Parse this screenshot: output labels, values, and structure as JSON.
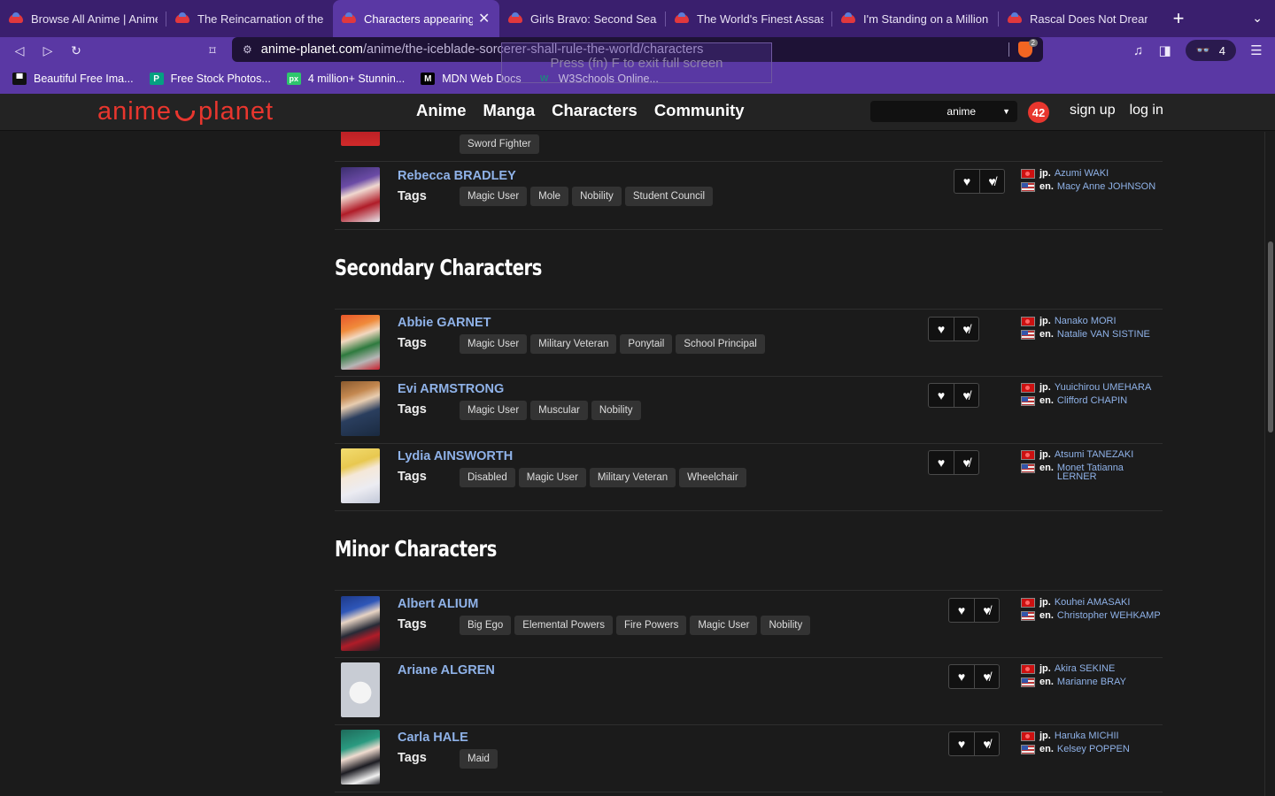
{
  "browser": {
    "tabs": [
      {
        "title": "Browse All Anime | Anime-Planet"
      },
      {
        "title": "The Reincarnation of the Strongest Exorcist"
      },
      {
        "title": "Characters appearing in The Iceblade Sorcerer",
        "active": true
      },
      {
        "title": "Girls Bravo: Second Season"
      },
      {
        "title": "The World's Finest Assassin"
      },
      {
        "title": "I'm Standing on a Million Lives"
      },
      {
        "title": "Rascal Does Not Dream of"
      }
    ],
    "url_host": "anime-planet.com",
    "url_path": "/anime/the-iceblade-sorcerer-shall-rule-the-world/characters",
    "shield_count": "2",
    "wallet_count": "4",
    "fullscreen_hint": "Press  (fn) F  to exit full screen",
    "bookmarks": [
      {
        "label": "Beautiful Free Ima...",
        "icon": "unsplash-icon"
      },
      {
        "label": "Free Stock Photos...",
        "icon": "pexels-icon",
        "icon_text": "P"
      },
      {
        "label": "4 million+ Stunnin...",
        "icon": "pixabay-icon",
        "icon_text": "px"
      },
      {
        "label": "MDN Web Docs",
        "icon": "mdn-icon",
        "icon_text": "M"
      },
      {
        "label": "W3Schools Online...",
        "icon": "w3schools-icon",
        "icon_text": "W"
      }
    ]
  },
  "site": {
    "logo": {
      "left": "anime",
      "right": "planet"
    },
    "nav": [
      "Anime",
      "Manga",
      "Characters",
      "Community"
    ],
    "search_type": "anime",
    "notifications": "42",
    "sign_up": "sign up",
    "log_in": "log in"
  },
  "colors": {
    "accent": "#e8362e",
    "link": "#8fb2e8",
    "browser_purple": "#5a38a4"
  },
  "partial_row": {
    "tags": [
      "Sword Fighter"
    ]
  },
  "main_characters_tail": [
    {
      "name": "Rebecca BRADLEY",
      "tags_label": "Tags",
      "tags": [
        "Magic User",
        "Mole",
        "Nobility",
        "Student Council"
      ],
      "jp": "Azumi WAKI",
      "en": "Macy Anne JOHNSON"
    }
  ],
  "secondary": {
    "heading": "Secondary Characters",
    "characters": [
      {
        "name": "Abbie GARNET",
        "tags_label": "Tags",
        "tags": [
          "Magic User",
          "Military Veteran",
          "Ponytail",
          "School Principal"
        ],
        "jp": "Nanako MORI",
        "en": "Natalie VAN SISTINE"
      },
      {
        "name": "Evi ARMSTRONG",
        "tags_label": "Tags",
        "tags": [
          "Magic User",
          "Muscular",
          "Nobility"
        ],
        "jp": "Yuuichirou UMEHARA",
        "en": "Clifford CHAPIN"
      },
      {
        "name": "Lydia AINSWORTH",
        "tags_label": "Tags",
        "tags": [
          "Disabled",
          "Magic User",
          "Military Veteran",
          "Wheelchair"
        ],
        "jp": "Atsumi TANEZAKI",
        "en": "Monet Tatianna LERNER"
      }
    ]
  },
  "minor": {
    "heading": "Minor Characters",
    "characters": [
      {
        "name": "Albert ALIUM",
        "tags_label": "Tags",
        "tags": [
          "Big Ego",
          "Elemental Powers",
          "Fire Powers",
          "Magic User",
          "Nobility"
        ],
        "jp": "Kouhei AMASAKI",
        "en": "Christopher WEHKAMP"
      },
      {
        "name": "Ariane ALGREN",
        "tags_label": "",
        "tags": [],
        "jp": "Akira SEKINE",
        "en": "Marianne BRAY"
      },
      {
        "name": "Carla HALE",
        "tags_label": "Tags",
        "tags": [
          "Maid"
        ],
        "jp": "Haruka MICHII",
        "en": "Kelsey POPPEN"
      }
    ]
  },
  "labels": {
    "jp": "jp.",
    "en": "en."
  }
}
